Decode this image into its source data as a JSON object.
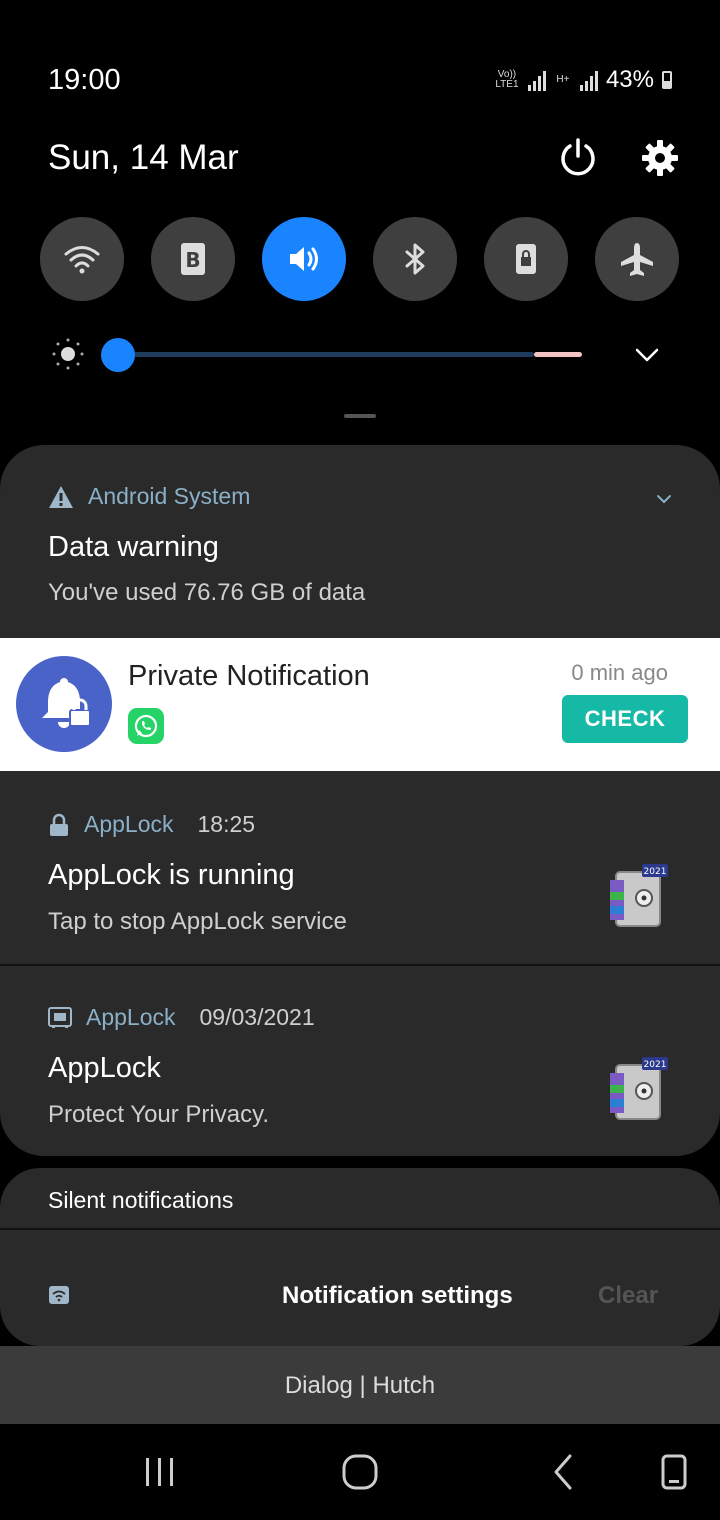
{
  "status_bar": {
    "time": "19:00",
    "sim1": "Vo)) LTE1",
    "sim2": "H+",
    "battery": "43%",
    "battery_level": 0.43
  },
  "header": {
    "date": "Sun, 14 Mar"
  },
  "quick_toggles": [
    {
      "name": "wifi",
      "active": false
    },
    {
      "name": "bixby",
      "active": false
    },
    {
      "name": "sound",
      "active": true
    },
    {
      "name": "bluetooth",
      "active": false
    },
    {
      "name": "lock",
      "active": false
    },
    {
      "name": "airplane",
      "active": false
    }
  ],
  "brightness": {
    "level": 0.0
  },
  "colors": {
    "accent": "#1a84ff",
    "check": "#16b8a6",
    "panel": "#2a2a2a",
    "app_label": "#8ab0c8"
  },
  "notifications": {
    "android": {
      "app": "Android System",
      "title": "Data warning",
      "body": "You've used 76.76 GB of data"
    },
    "private": {
      "title": "Private Notification",
      "time": "0 min ago",
      "button": "CHECK"
    },
    "applock1": {
      "app": "AppLock",
      "time": "18:25",
      "title": "AppLock is running",
      "body": "Tap to stop AppLock service",
      "badge": "2021"
    },
    "applock2": {
      "app": "AppLock",
      "time": "09/03/2021",
      "title": "AppLock",
      "body": "Protect Your Privacy.",
      "badge": "2021"
    }
  },
  "silent": {
    "label": "Silent notifications"
  },
  "footer": {
    "settings": "Notification settings",
    "clear": "Clear",
    "carrier": "Dialog | Hutch"
  }
}
